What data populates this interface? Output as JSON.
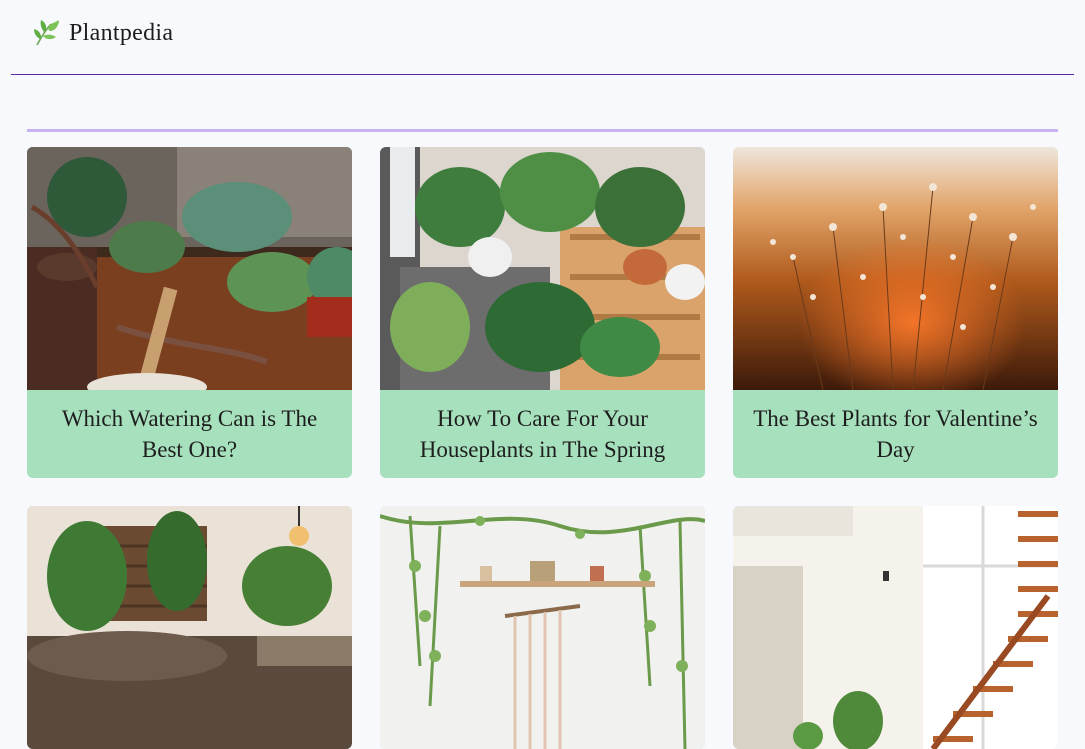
{
  "site": {
    "name": "Plantpedia",
    "logo_icon": "leaf-icon",
    "header_line_color": "#5b2aa3",
    "divider_color": "#c9b3f5"
  },
  "cards": [
    {
      "title": "Which Watering Can is The Best One?",
      "image": "succulents-watering-can-image",
      "bg": "#a6e0bd"
    },
    {
      "title": "How To Care For Your Houseplants in The Spring",
      "image": "houseplants-shelf-image",
      "bg": "#a6e0bd"
    },
    {
      "title": "The Best Plants for Valentine’s Day",
      "image": "wildflowers-sunset-image",
      "bg": "#a6e0bd"
    },
    {
      "title": "",
      "image": "living-room-plants-image"
    },
    {
      "title": "",
      "image": "hanging-vines-shelf-image"
    },
    {
      "title": "",
      "image": "staircase-interior-image"
    }
  ]
}
